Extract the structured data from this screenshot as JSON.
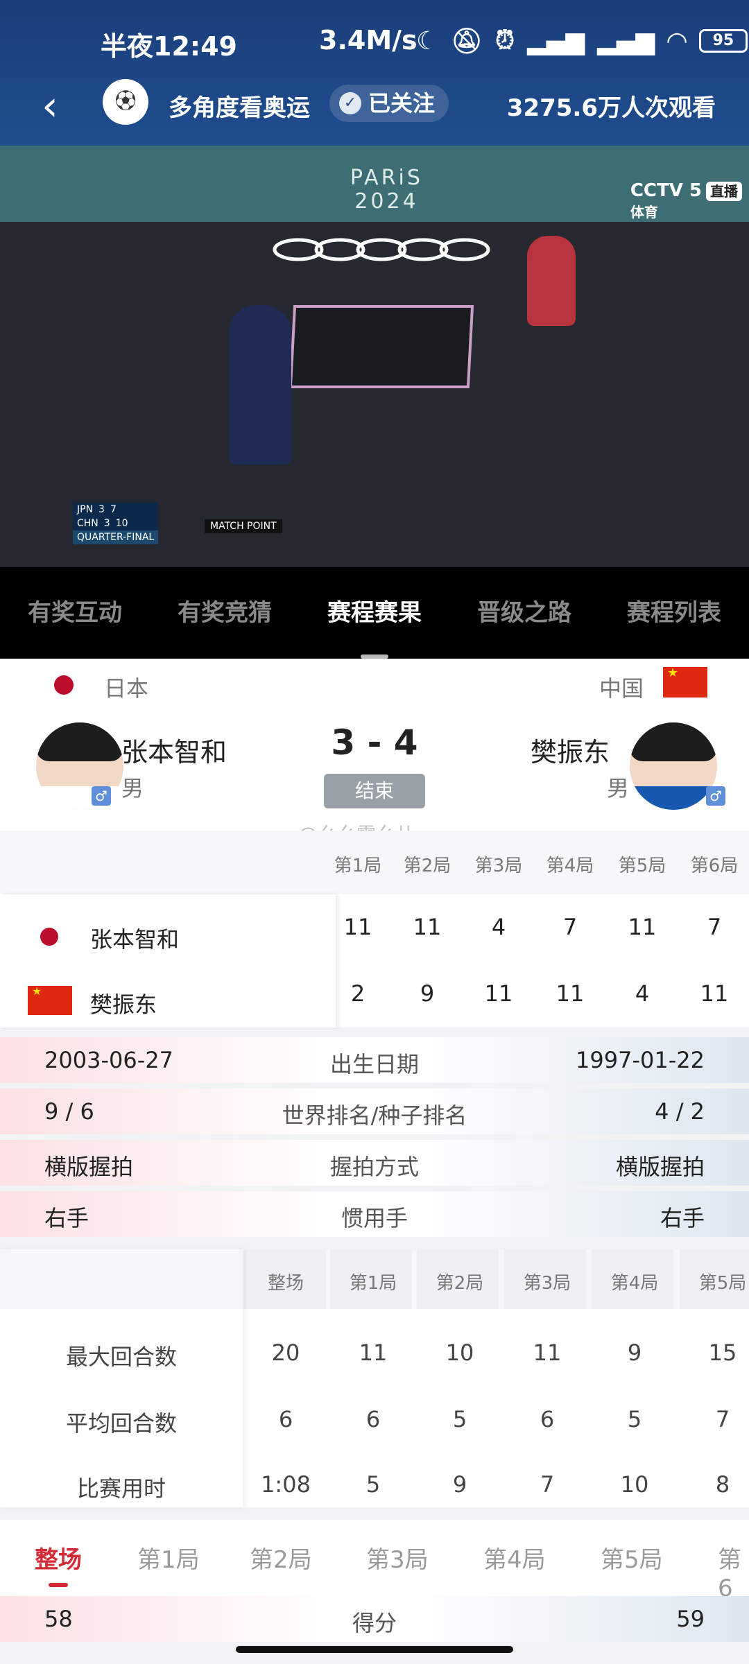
{
  "status_bar": {
    "time": "半夜12:49",
    "speed": "3.4M/s",
    "icons": [
      "moon-icon",
      "bell-off-icon",
      "alarm-icon",
      "signal-icon",
      "signal-icon",
      "wifi-icon"
    ],
    "battery": "95"
  },
  "header": {
    "channel": "多角度看奥运",
    "follow_label": "已关注",
    "views": "3275.6万人次观看"
  },
  "video": {
    "wall_text_1": "PARiS",
    "wall_text_2": "2024",
    "broadcaster": "CCTV 5",
    "broadcaster_sub": "体育",
    "live": "直播",
    "scoreboard": {
      "rows": [
        [
          "JPN",
          "3",
          "7"
        ],
        [
          "CHN",
          "3",
          "10"
        ]
      ],
      "note": "MATCH POINT",
      "round": "QUARTER-FINAL"
    }
  },
  "tabs": [
    "有奖互动",
    "有奖竞猜",
    "赛程赛果",
    "晋级之路",
    "赛程列表"
  ],
  "active_tab": 2,
  "match": {
    "left": {
      "country": "日本",
      "name": "张本智和",
      "gender": "男"
    },
    "right": {
      "country": "中国",
      "name": "樊振东",
      "gender": "男"
    },
    "score": "3 - 4",
    "status": "结束"
  },
  "watermark": "@幺幺零幺儿",
  "sets": {
    "headers": [
      "第1局",
      "第2局",
      "第3局",
      "第4局",
      "第5局",
      "第6局"
    ],
    "players": [
      {
        "name": "张本智和",
        "scores": [
          "11",
          "11",
          "4",
          "7",
          "11",
          "7"
        ]
      },
      {
        "name": "樊振东",
        "scores": [
          "2",
          "9",
          "11",
          "11",
          "4",
          "11"
        ]
      }
    ]
  },
  "info_rows": [
    {
      "left": "2003-06-27",
      "label": "出生日期",
      "right": "1997-01-22"
    },
    {
      "left": "9 / 6",
      "label": "世界排名/种子排名",
      "right": "4 / 2"
    },
    {
      "left": "横版握拍",
      "label": "握拍方式",
      "right": "横版握拍"
    },
    {
      "left": "右手",
      "label": "惯用手",
      "right": "右手"
    }
  ],
  "stats": {
    "headers": [
      "整场",
      "第1局",
      "第2局",
      "第3局",
      "第4局",
      "第5局"
    ],
    "rows": [
      {
        "label": "最大回合数",
        "values": [
          "20",
          "11",
          "10",
          "11",
          "9",
          "15"
        ]
      },
      {
        "label": "平均回合数",
        "values": [
          "6",
          "6",
          "5",
          "6",
          "5",
          "7"
        ]
      },
      {
        "label": "比赛用时",
        "values": [
          "1:08",
          "5",
          "9",
          "7",
          "10",
          "8"
        ]
      }
    ]
  },
  "bottom_tabs": [
    "整场",
    "第1局",
    "第2局",
    "第3局",
    "第4局",
    "第5局",
    "第6"
  ],
  "score_row": {
    "left": "58",
    "label": "得分",
    "right": "59"
  }
}
